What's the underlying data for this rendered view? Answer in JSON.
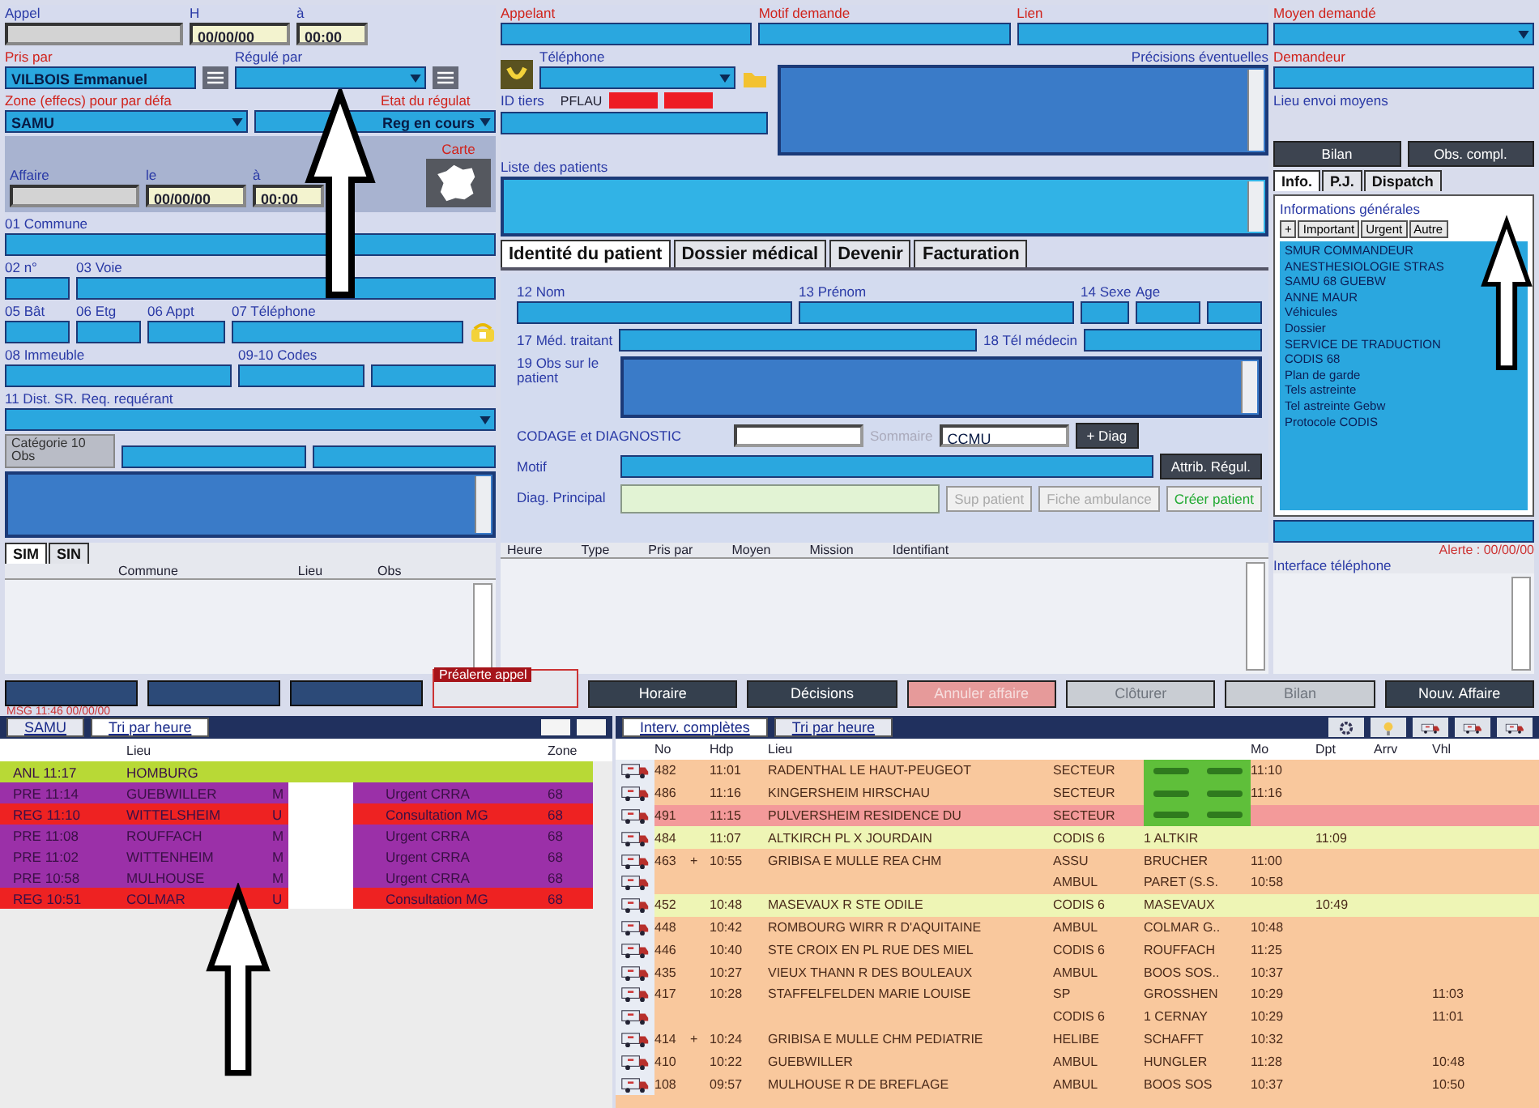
{
  "left": {
    "appel": {
      "label": "Appel",
      "kind": "grey"
    },
    "appel_date": {
      "label": "H",
      "kind": "date",
      "value": "00/00/00"
    },
    "appel_time": {
      "label": "à",
      "kind": "date",
      "value": "00:00"
    },
    "pris_par": {
      "label": "Pris par",
      "kind": "text",
      "value": "VILBOIS Emmanuel",
      "required": true
    },
    "regule_par": {
      "label": "Régulé par",
      "kind": "select",
      "required": false
    },
    "zone": {
      "label": "Zone (effecs) pour par défa",
      "kind": "select",
      "value": "SAMU",
      "required": true
    },
    "etat": {
      "label": "Etat du régulat",
      "kind": "select",
      "value": "Reg en cours",
      "required": true
    },
    "affaire": {
      "label": "Affaire",
      "kind": "grey"
    },
    "affaire_date": {
      "label": "le",
      "kind": "date",
      "value": "00/00/00"
    },
    "affaire_time": {
      "label": "à",
      "kind": "date",
      "value": "00:00"
    },
    "carte": {
      "label": "Carte",
      "required": true
    },
    "commune": {
      "label": "01 Commune",
      "kind": "text"
    },
    "numero": {
      "label": "02 n°",
      "kind": "text"
    },
    "voie": {
      "label": "03 Voie",
      "kind": "text"
    },
    "bat": {
      "label": "05 Bât",
      "kind": "text"
    },
    "etage": {
      "label": "06 Etg",
      "kind": "text"
    },
    "appt": {
      "label": "06 Appt",
      "kind": "text"
    },
    "telephone": {
      "label": "07 Téléphone",
      "kind": "text"
    },
    "immeuble": {
      "label": "08 Immeuble",
      "kind": "text"
    },
    "codes": {
      "label": "09-10 Codes",
      "kind": "text"
    },
    "codes_2": {
      "kind": "text"
    },
    "dist": {
      "label": "11 Dist. SR. Req. requérant",
      "kind": "select"
    },
    "categorie": "Catégorie 10 Obs",
    "categorie_1": {
      "kind": "text"
    },
    "categorie_2": {
      "kind": "text"
    },
    "obs": {
      "kind": "area"
    }
  },
  "middle": {
    "appelant": {
      "label": "Appelant",
      "kind": "text",
      "required": true
    },
    "motif": {
      "label": "Motif demande",
      "kind": "text",
      "required": true
    },
    "lien": {
      "label": "Lien",
      "kind": "text",
      "required": true
    },
    "telephone": {
      "label": "Téléphone",
      "kind": "select"
    },
    "id_tiers": {
      "label": "ID tiers",
      "kind": "text"
    },
    "tiers_code": "PFLAU",
    "flags": [
      {
        "color": "#ee1c24"
      },
      {
        "color": "#ee1c24"
      }
    ],
    "precisions": {
      "label": "Précisions éventuelles",
      "kind": "area"
    },
    "patients": {
      "label": "Liste des patients",
      "kind": "list"
    },
    "tabs": [
      {
        "label": "Identité du patient",
        "selected": true
      },
      {
        "label": "Dossier médical",
        "selected": false
      },
      {
        "label": "Devenir",
        "selected": false
      },
      {
        "label": "Facturation",
        "selected": false
      }
    ],
    "nom": {
      "label": "12 Nom",
      "kind": "text"
    },
    "prenom": {
      "label": "13 Prénom",
      "kind": "text"
    },
    "sexe": {
      "label": "14 Sexe",
      "kind": "text"
    },
    "age": {
      "label": "Age",
      "kind": "text"
    },
    "age_unit": {
      "kind": "text"
    },
    "medecin": {
      "label": "17 Méd. traitant",
      "kind": "text"
    },
    "tel_medecin": {
      "label": "18 Tél médecin",
      "kind": "text"
    },
    "obs": {
      "label": "19 Obs sur le patient",
      "kind": "area"
    },
    "codage": {
      "label": "CODAGE et DIAGNOSTIC",
      "kind": "white"
    },
    "sommaire": "Sommaire",
    "code": {
      "kind": "white",
      "value": "CCMU"
    },
    "motif_patient": {
      "label": "Motif",
      "kind": "text"
    },
    "diag": {
      "label": "Diag. Principal",
      "kind": "green"
    },
    "diag_button": "+ Diag",
    "attrib_button": "Attrib. Régul.",
    "buttons": [
      {
        "label": "Sup patient",
        "disabled": true
      },
      {
        "label": "Fiche ambulance",
        "disabled": true
      },
      {
        "label": "Créer patient",
        "disabled": false
      }
    ]
  },
  "right": {
    "moyen": {
      "label": "Moyen demandé",
      "kind": "select",
      "required": true
    },
    "demandeur": {
      "label": "Demandeur",
      "kind": "text",
      "required": true
    },
    "lieu_envoi": "Lieu envoi moyens",
    "buttons": [
      "Bilan",
      "Obs. compl."
    ],
    "tabs": [
      {
        "label": "Info.",
        "selected": true
      },
      {
        "label": "P.J.",
        "selected": false
      },
      {
        "label": "Dispatch",
        "selected": false
      }
    ],
    "info_title": "Informations générales",
    "filters": [
      "+",
      "Important",
      "Urgent",
      "Autre"
    ],
    "info_items": [
      "SMUR COMMANDEUR",
      "ANESTHESIOLOGIE STRAS",
      "SAMU 68 GUEBW",
      "ANNE MAUR",
      "Véhicules",
      "Dossier",
      "SERVICE DE TRADUCTION",
      "CODIS 68",
      "Plan de garde",
      "Tels astreinte",
      "Tel astreinte Gebw",
      "Protocole CODIS"
    ],
    "bottom_field": {
      "kind": "text"
    }
  },
  "strip": {
    "tabs": [
      {
        "label": "SIM",
        "selected": true
      },
      {
        "label": "SIN",
        "selected": false
      }
    ],
    "columns": [
      "Commune",
      "Lieu",
      "Obs"
    ],
    "history_columns": [
      "Heure",
      "Type",
      "Pris par",
      "Moyen",
      "Mission",
      "Identifiant"
    ],
    "alert": "Alerte : 00/00/00",
    "phone_interface": "Interface téléphone",
    "left_buttons": [
      {
        "disabled": false
      },
      {
        "disabled": false
      },
      {
        "disabled": false
      }
    ],
    "prealert": "Préalerte appel",
    "actions": [
      {
        "label": "Horaire",
        "kind": "dark"
      },
      {
        "label": "Décisions",
        "kind": "dark"
      },
      {
        "label": "Annuler affaire",
        "kind": "danger"
      },
      {
        "label": "Clôturer",
        "kind": "disabled"
      },
      {
        "label": "Bilan",
        "kind": "disabled"
      },
      {
        "label": "Nouv. Affaire",
        "kind": "dark"
      }
    ],
    "message": "MSG 11:46 00/00/00"
  },
  "queue": {
    "tabs": [
      {
        "label": "SAMU",
        "selected": false
      },
      {
        "label": "Tri par heure",
        "selected": true
      }
    ],
    "columns": {
      "lieu": "Lieu",
      "zone": "Zone"
    },
    "rows": [
      {
        "time": "ANL 11:17",
        "lieu": "HOMBURG",
        "color": "#b8d936"
      },
      {
        "time": "PRE 11:14",
        "lieu": "GUEBWILLER",
        "code": "M",
        "motif": "Urgent CRRA",
        "zone": "68",
        "color": "#9b30a8"
      },
      {
        "time": "REG 11:10",
        "lieu": "WITTELSHEIM",
        "code": "U",
        "motif": "Consultation MG",
        "zone": "68",
        "color": "#ee2222"
      },
      {
        "time": "PRE 11:08",
        "lieu": "ROUFFACH",
        "code": "M",
        "motif": "Urgent CRRA",
        "zone": "68",
        "color": "#9b30a8"
      },
      {
        "time": "PRE 11:02",
        "lieu": "WITTENHEIM",
        "code": "M",
        "motif": "Urgent CRRA",
        "zone": "68",
        "color": "#9b30a8"
      },
      {
        "time": "PRE 10:58",
        "lieu": "MULHOUSE",
        "code": "M",
        "motif": "Urgent CRRA",
        "zone": "68",
        "color": "#9b30a8"
      },
      {
        "time": "REG 10:51",
        "lieu": "COLMAR",
        "code": "U",
        "motif": "Consultation MG",
        "zone": "68",
        "color": "#ee2222"
      }
    ]
  },
  "interventions": {
    "tabs": [
      {
        "label": "Interv. complètes",
        "selected": true
      },
      {
        "label": "Tri par heure",
        "selected": false
      }
    ],
    "columns": {
      "no": "No",
      "time": "Hdp",
      "lieu": "Lieu",
      "mo": "Mo",
      "dpt": "Dpt",
      "arr": "Arrv",
      "vhl": "Vhl"
    },
    "rows": [
      {
        "no": "482",
        "time": "11:01",
        "lieu": "RADENTHAL LE HAUT-PEUGEOT",
        "type": "SECTEUR",
        "dispatched": true,
        "mo": "11:10",
        "color": "#f9c89d"
      },
      {
        "no": "486",
        "time": "11:16",
        "lieu": "KINGERSHEIM    HIRSCHAU",
        "type": "SECTEUR",
        "dispatched": true,
        "mo": "11:16",
        "color": "#f9c89d"
      },
      {
        "no": "491",
        "time": "11:15",
        "lieu": "PULVERSHEIM    RESIDENCE DU",
        "type": "SECTEUR",
        "dispatched": true,
        "color": "#f39a9a"
      },
      {
        "no": "484",
        "time": "11:07",
        "lieu": "ALTKIRCH    PL X JOURDAIN",
        "type": "CODIS 6",
        "moyen": "1 ALTKIR",
        "dpt": "11:09",
        "color": "#eef5b5"
      },
      {
        "no": "463",
        "flag": "+",
        "time": "10:55",
        "lieu": "GRIBISA E  MULLE REA CHM",
        "type": "ASSU",
        "moyen": "BRUCHER",
        "mo": "11:00",
        "color": "#f9c89d"
      },
      {
        "type": "AMBUL",
        "moyen": "PARET (S.S.",
        "mo": "10:58",
        "color": "#f9c89d"
      },
      {
        "no": "452",
        "time": "10:48",
        "lieu": "MASEVAUX    R STE ODILE",
        "type": "CODIS 6",
        "moyen": "MASEVAUX",
        "dpt": "10:49",
        "color": "#eef5b5"
      },
      {
        "no": "448",
        "time": "10:42",
        "lieu": "ROMBOURG WIRR  R D'AQUITAINE",
        "type": "AMBUL",
        "moyen": "COLMAR G..",
        "mo": "10:48",
        "color": "#f9c89d"
      },
      {
        "no": "446",
        "time": "10:40",
        "lieu": "STE CROIX EN PL RUE DES MIEL",
        "type": "CODIS 6",
        "moyen": "ROUFFACH",
        "mo": "11:25",
        "color": "#f9c89d"
      },
      {
        "no": "435",
        "time": "10:27",
        "lieu": "VIEUX THANN   R DES BOULEAUX",
        "type": "AMBUL",
        "moyen": "BOOS SOS..",
        "mo": "10:37",
        "color": "#f9c89d"
      },
      {
        "no": "417",
        "time": "10:28",
        "lieu": "STAFFELFELDEN   MARIE LOUISE",
        "type": "SP",
        "moyen": "GROSSHEN",
        "mo": "10:29",
        "vhl": "11:03",
        "color": "#f9c89d"
      },
      {
        "type": "CODIS 6",
        "moyen": "1 CERNAY",
        "mo": "10:29",
        "vhl": "11:01",
        "color": "#f9c89d"
      },
      {
        "no": "414",
        "flag": "+",
        "time": "10:24",
        "lieu": "GRIBISA E  MULLE CHM PEDIATRIE",
        "type": "HELIBE",
        "moyen": "SCHAFFT",
        "mo": "10:32",
        "color": "#f9c89d"
      },
      {
        "no": "410",
        "time": "10:22",
        "lieu": "GUEBWILLER",
        "type": "AMBUL",
        "moyen": "HUNGLER",
        "mo": "11:28",
        "vhl": "10:48",
        "color": "#f9c89d"
      },
      {
        "no": "108",
        "time": "09:57",
        "lieu": "MULHOUSE    R DE BREFLAGE",
        "type": "AMBUL",
        "moyen": "BOOS SOS",
        "mo": "10:37",
        "vhl": "10:50",
        "color": "#f9c89d"
      }
    ]
  }
}
